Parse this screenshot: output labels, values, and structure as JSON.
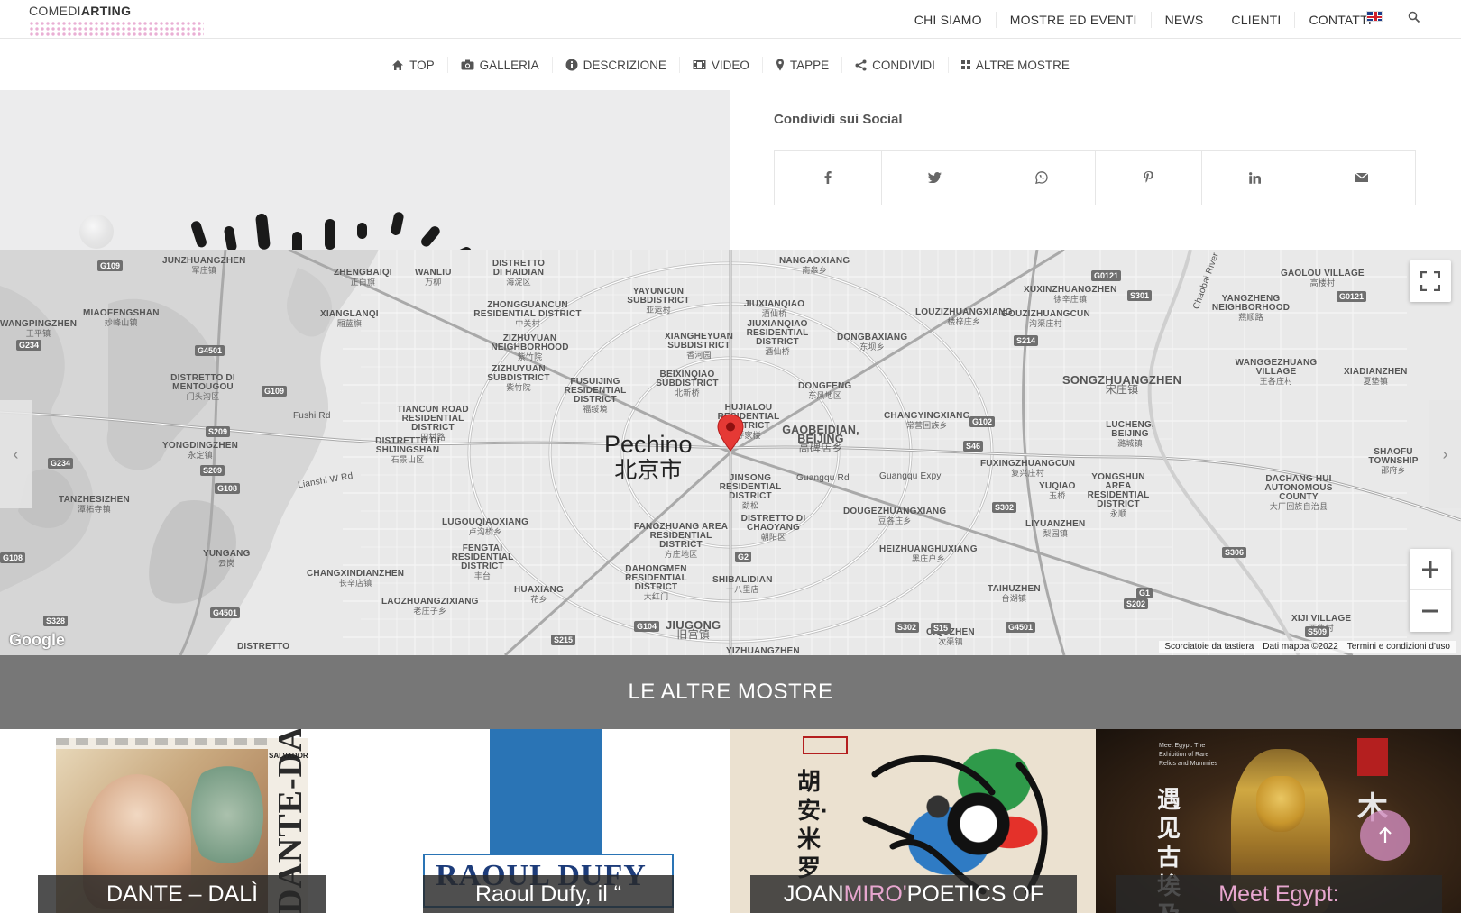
{
  "header": {
    "logo_text_light": "COMEDI",
    "logo_text_bold": "ARTING",
    "nav": [
      "CHI SIAMO",
      "MOSTRE ED EVENTI",
      "NEWS",
      "CLIENTI",
      "CONTATTI"
    ]
  },
  "subnav": [
    {
      "label": "TOP",
      "icon": "home-icon"
    },
    {
      "label": "GALLERIA",
      "icon": "camera-icon"
    },
    {
      "label": "DESCRIZIONE",
      "icon": "info-icon"
    },
    {
      "label": "VIDEO",
      "icon": "video-icon"
    },
    {
      "label": "TAPPE",
      "icon": "map-pin-icon"
    },
    {
      "label": "CONDIVIDI",
      "icon": "share-icon"
    },
    {
      "label": "ALTRE MOSTRE",
      "icon": "grid-icon"
    }
  ],
  "share": {
    "title": "Condividi sui Social",
    "buttons": [
      "facebook-icon",
      "twitter-icon",
      "whatsapp-icon",
      "pinterest-icon",
      "linkedin-icon",
      "email-icon"
    ]
  },
  "map": {
    "city": "Pechino",
    "city_cn": "北京市",
    "brand": "Google",
    "attribution": [
      "Scorciatoie da tastiera",
      "Dati mappa ©2022",
      "Termini e condizioni d'uso"
    ],
    "labels": [
      {
        "t": "JUNZHUANGZHEN",
        "c": "军庄镇"
      },
      {
        "t": "ZHENGBAIQI",
        "c": "正白旗"
      },
      {
        "t": "WANLIU",
        "c": "万柳"
      },
      {
        "t": "DISTRETTO DI HAIDIAN",
        "c": "海淀区"
      },
      {
        "t": "NANGAOXIANG",
        "c": "南皋乡"
      },
      {
        "t": "XUXINZHUANGZHEN",
        "c": "徐辛庄镇"
      },
      {
        "t": "GAOLOU VILLAGE",
        "c": "高楼村"
      },
      {
        "t": "MIAOFENGSHAN",
        "c": "妙峰山镇"
      },
      {
        "t": "WANGPINGZHEN",
        "c": "王平镇"
      },
      {
        "t": "XIANGLANQI",
        "c": "厢蓝旗"
      },
      {
        "t": "ZHONGGUANCUN RESIDENTIAL DISTRICT",
        "c": "中关村"
      },
      {
        "t": "YAYUNCUN SUBDISTRICT",
        "c": "亚运村"
      },
      {
        "t": "JIUXIANQIAO",
        "c": "酒仙桥"
      },
      {
        "t": "LOUZIZHUANGXIANG",
        "c": "楼梓庄乡"
      },
      {
        "t": "GOUZIZHUANGCUN",
        "c": "沟渠庄村"
      },
      {
        "t": "YANGZHENG NEIGHBORHOOD",
        "c": "燕顺路"
      },
      {
        "t": "ZIZHUYUAN NEIGHBORHOOD",
        "c": "紫竹院"
      },
      {
        "t": "XIANGHEYUAN SUBDISTRICT",
        "c": "香河园"
      },
      {
        "t": "JIUXIANQIAO RESIDENTIAL DISTRICT",
        "c": "酒仙桥"
      },
      {
        "t": "DONGBAXIANG",
        "c": "东坝乡"
      },
      {
        "t": "WANGGEZHUANG VILLAGE",
        "c": "王各庄村"
      },
      {
        "t": "XIADIANZHEN",
        "c": "夏垫镇"
      },
      {
        "t": "DISTRETTO DI MENTOUGOU",
        "c": "门头沟区"
      },
      {
        "t": "ZIZHUYUAN SUBDISTRICT",
        "c": "紫竹院"
      },
      {
        "t": "FUSUIJING RESIDENTIAL DISTRICT",
        "c": "福绥境"
      },
      {
        "t": "BEIXINQIAO SUBDISTRICT",
        "c": "北新桥"
      },
      {
        "t": "DONGFENG",
        "c": "东风地区"
      },
      {
        "t": "SONGZHUANGZHEN",
        "c": "宋庄镇"
      },
      {
        "t": "TIANCUN ROAD RESIDENTIAL DISTRICT",
        "c": "田村路"
      },
      {
        "t": "HUJIALOU RESIDENTIAL DISTRICT",
        "c": "呼家楼"
      },
      {
        "t": "CHANGYINGXIANG",
        "c": "常营回族乡"
      },
      {
        "t": "YONGDINGZHEN",
        "c": "永定镇"
      },
      {
        "t": "DISTRETTO DI SHIJINGSHAN",
        "c": "石景山区"
      },
      {
        "t": "GAOBEIDIAN, BEIJING",
        "c": "高碑店乡"
      },
      {
        "t": "LUCHENG, BEIJING",
        "c": "潞城镇"
      },
      {
        "t": "SHAOFU TOWNSHIP",
        "c": "邵府乡"
      },
      {
        "t": "FUXINGZHUANGCUN",
        "c": "复兴庄村"
      },
      {
        "t": "TANZHESIZHEN",
        "c": "潭柘寺镇"
      },
      {
        "t": "JINSONG RESIDENTIAL DISTRICT",
        "c": "劲松"
      },
      {
        "t": "YUQIAO",
        "c": "玉桥"
      },
      {
        "t": "YONGSHUN AREA RESIDENTIAL DISTRICT",
        "c": "永顺"
      },
      {
        "t": "DACHANG HUI AUTONOMOUS COUNTY",
        "c": "大厂回族自治县"
      },
      {
        "t": "LUGOUQIAOXIANG",
        "c": "卢沟桥乡"
      },
      {
        "t": "DISTRETTO DI CHAOYANG",
        "c": "朝阳区"
      },
      {
        "t": "DOUGEZHUANGXIANG",
        "c": "豆各庄乡"
      },
      {
        "t": "LIYUANZHEN",
        "c": "梨园镇"
      },
      {
        "t": "FANGZHUANG AREA RESIDENTIAL DISTRICT",
        "c": "方庄地区"
      },
      {
        "t": "FENGTAI RESIDENTIAL DISTRICT",
        "c": "丰台"
      },
      {
        "t": "YUNGANG",
        "c": "云岗"
      },
      {
        "t": "HEIZHUANGHUXIANG",
        "c": "黑庄户乡"
      },
      {
        "t": "CHANGXINDIANZHEN",
        "c": "长辛店镇"
      },
      {
        "t": "HUAXIANG",
        "c": "花乡"
      },
      {
        "t": "DAHONGMEN RESIDENTIAL DISTRICT",
        "c": "大红门"
      },
      {
        "t": "SHIBALIDIAN",
        "c": "十八里店"
      },
      {
        "t": "TAIHUZHEN",
        "c": "台湖镇"
      },
      {
        "t": "XIJI VILLAGE",
        "c": "西集村"
      },
      {
        "t": "LAOZHUANGZIXIANG",
        "c": "老庄子乡"
      },
      {
        "t": "JIUGONG",
        "c": "旧宫镇"
      },
      {
        "t": "CIQUZHEN",
        "c": "次渠镇"
      },
      {
        "t": "DISTRETTO",
        "c": ""
      },
      {
        "t": "YIZHUANGZHEN",
        "c": ""
      }
    ],
    "road_names": [
      "Fushi Rd",
      "Lianshi W Rd",
      "Guangqu Rd",
      "Guangqu Expy",
      "Chaobai River"
    ],
    "shields": [
      "G109",
      "G4501",
      "G234",
      "G109",
      "S209",
      "G234",
      "S209",
      "G108",
      "G108",
      "S328",
      "G4501",
      "G0121",
      "S301",
      "G0121",
      "S214",
      "G102",
      "S46",
      "S302",
      "S306",
      "S202",
      "G1",
      "S509",
      "S302",
      "S15",
      "G4501",
      "G104",
      "S215",
      "G2"
    ]
  },
  "others": {
    "title": "LE ALTRE MOSTRE",
    "cards": [
      {
        "pre": "DANTE – DALÌ",
        "hl": "",
        "post": "",
        "poster_text": "DANTE-DALÍ",
        "poster_sub": "SALVADOR"
      },
      {
        "pre": "Raoul Dufy, il “",
        "hl": "",
        "post": "",
        "poster_text": "RAOUL DUFY"
      },
      {
        "pre": "JOAN ",
        "hl": "MIRO'",
        "post": " POETICS OF",
        "poster_text": "胡安·米罗"
      },
      {
        "pre": "",
        "hl": "Meet Egypt:",
        "post": "",
        "poster_text": "遇见古埃及",
        "poster_sub": "Meet Egypt: The Exhibition of Rare Relics and Mummies"
      }
    ]
  }
}
